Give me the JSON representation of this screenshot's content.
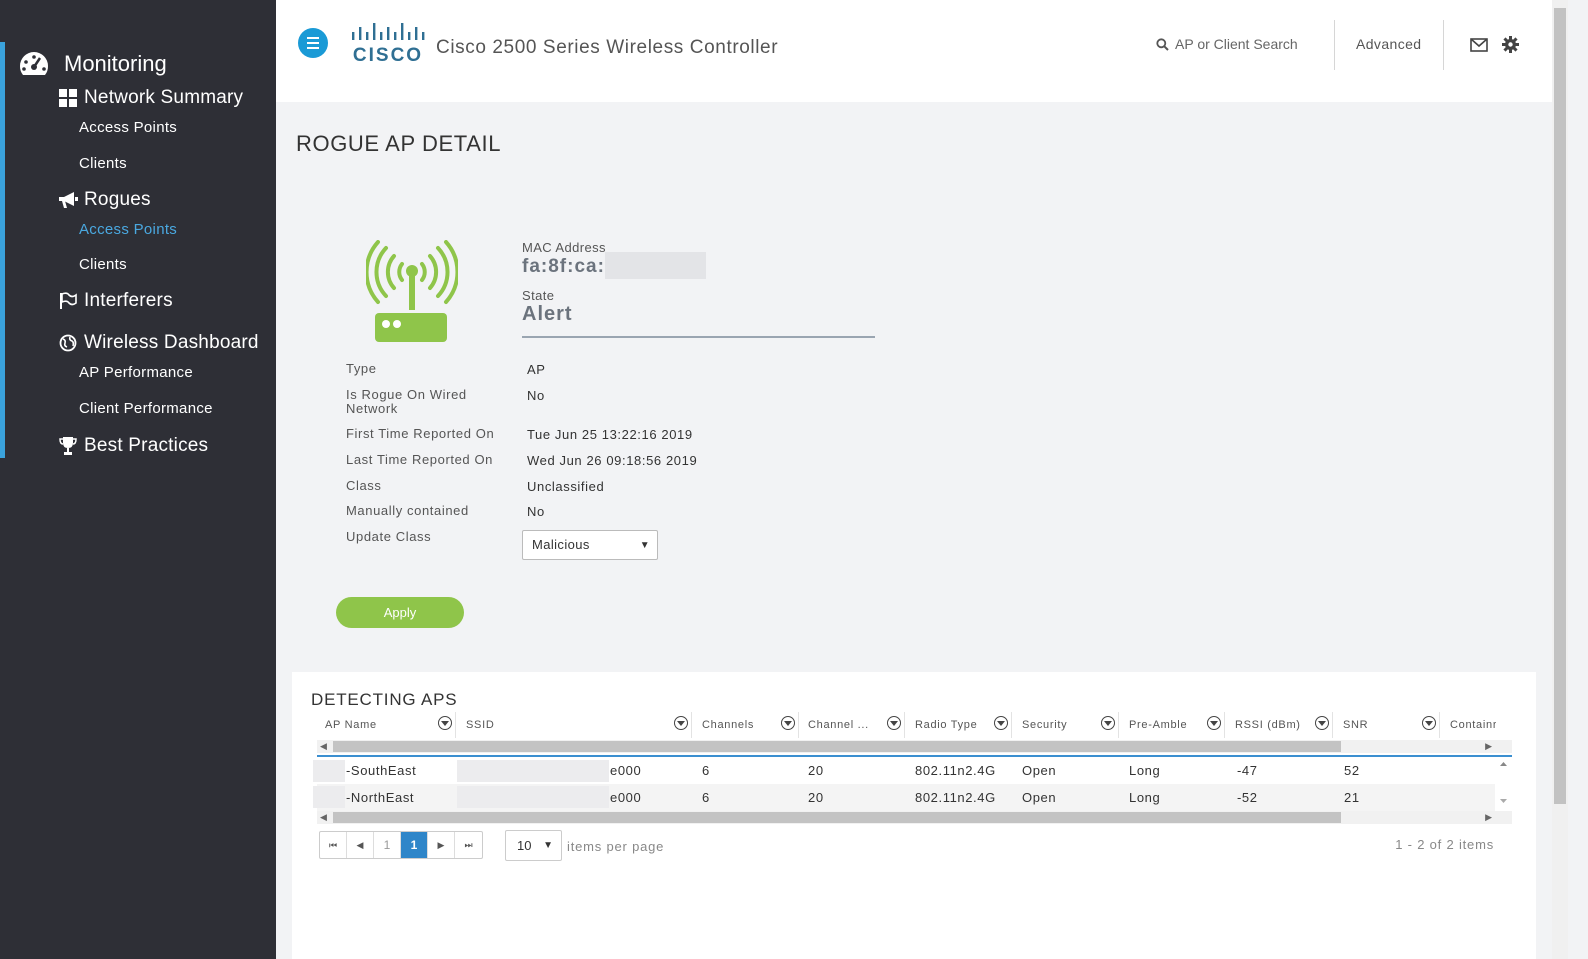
{
  "sidebar": {
    "monitoring": "Monitoring",
    "network_summary": "Network Summary",
    "ns_access_points": "Access Points",
    "ns_clients": "Clients",
    "rogues": "Rogues",
    "rogue_access_points": "Access Points",
    "rogue_clients": "Clients",
    "interferers": "Interferers",
    "wireless_dashboard": "Wireless Dashboard",
    "ap_performance": "AP Performance",
    "client_performance": "Client Performance",
    "best_practices": "Best Practices",
    "active_color": "#4aa8e0"
  },
  "header": {
    "app_title": "Cisco 2500 Series Wireless Controller",
    "search_placeholder": "AP or Client Search",
    "advanced": "Advanced"
  },
  "page": {
    "title": "ROGUE AP DETAIL"
  },
  "detail": {
    "mac_label": "MAC Address",
    "mac_value": "fa:8f:ca:",
    "state_label": "State",
    "state_value": "Alert",
    "rows": [
      {
        "label": "Type",
        "value": "AP"
      },
      {
        "label": "Is Rogue On Wired Network",
        "value": "No"
      },
      {
        "label": "First Time Reported On",
        "value": "Tue Jun 25 13:22:16 2019"
      },
      {
        "label": "Last Time Reported On",
        "value": "Wed Jun 26 09:18:56 2019"
      },
      {
        "label": "Class",
        "value": "Unclassified"
      },
      {
        "label": "Manually contained",
        "value": "No"
      },
      {
        "label": "Update Class",
        "value": ""
      }
    ],
    "update_class_selected": "Malicious",
    "apply_label": "Apply",
    "accent_color": "#8fc54a"
  },
  "detecting": {
    "title": "DETECTING APS",
    "columns": [
      "AP Name",
      "SSID",
      "Channels",
      "Channel ...",
      "Radio Type",
      "Security",
      "Pre-Amble",
      "RSSI (dBm)",
      "SNR",
      "Containr"
    ],
    "rows": [
      {
        "ap_name": "-SouthEast",
        "ssid": "e000",
        "channels": "6",
        "channel_width": "20",
        "radio_type": "802.11n2.4G",
        "security": "Open",
        "preamble": "Long",
        "rssi": "-47",
        "snr": "52"
      },
      {
        "ap_name": "-NorthEast",
        "ssid": "e000",
        "channels": "6",
        "channel_width": "20",
        "radio_type": "802.11n2.4G",
        "security": "Open",
        "preamble": "Long",
        "rssi": "-52",
        "snr": "21"
      }
    ],
    "pager": {
      "first": "⏮",
      "prev": "◀",
      "page_prev": "1",
      "page_current": "1",
      "next": "▶",
      "last": "⏭"
    },
    "per_page_value": "10",
    "per_page_label": "items per page",
    "item_count": "1 - 2 of 2 items"
  }
}
